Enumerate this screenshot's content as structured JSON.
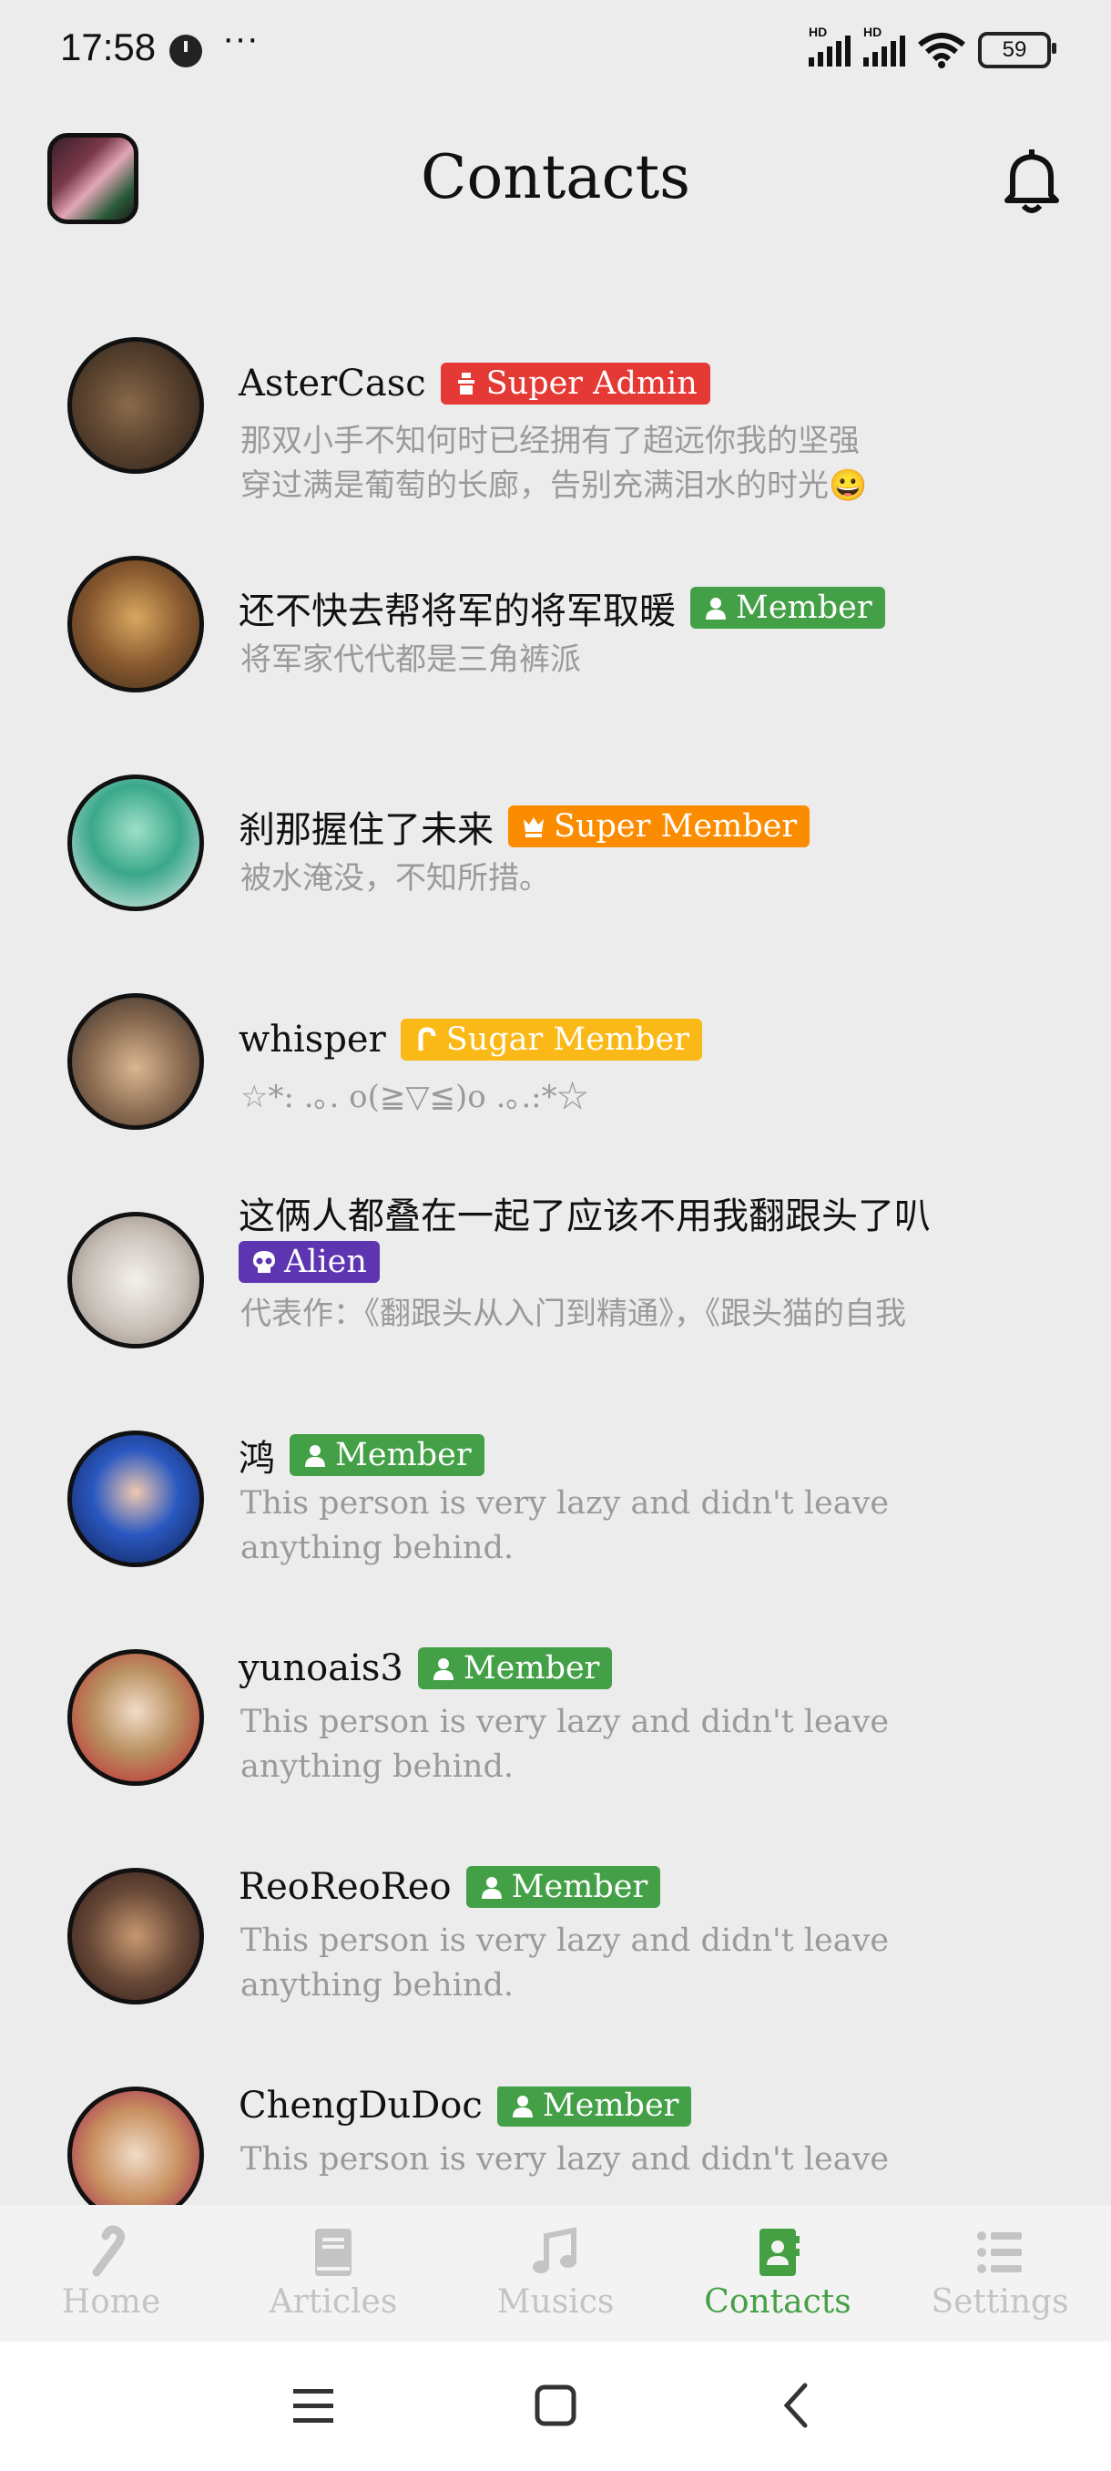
{
  "status": {
    "time": "17:58",
    "dots": "···",
    "battery": "59",
    "hd1": "HD",
    "hd2": "HD"
  },
  "header": {
    "title": "Contacts"
  },
  "contacts": [
    {
      "name": "AsterCasc",
      "badge": "Super Admin",
      "badge_color": "#e53935",
      "badge_icon": "admin-icon",
      "desc_lines": [
        "那双小手不知何时已经拥有了超远你我的坚强",
        "穿过满是葡萄的长廊，告别充满泪水的时光😀"
      ]
    },
    {
      "name": "还不快去帮将军的将军取暖",
      "badge": "Member",
      "badge_color": "#43a047",
      "badge_icon": "person-icon",
      "desc_lines": [
        "将军家代代都是三角裤派"
      ]
    },
    {
      "name": "刹那握住了未来",
      "badge": "Super Member",
      "badge_color": "#fb8c00",
      "badge_icon": "crown-icon",
      "desc_lines": [
        "被水淹没，不知所措。"
      ]
    },
    {
      "name": "whisper",
      "badge": "Sugar Member",
      "badge_color": "#fbb917",
      "badge_icon": "candy-icon",
      "desc_lines": [
        "☆*: .｡. o(≧▽≦)o .｡.:*☆"
      ]
    },
    {
      "name": "这俩人都叠在一起了应该不用我翻跟头了叭",
      "badge": "Alien",
      "badge_color": "#5e35b1",
      "badge_icon": "skull-icon",
      "desc_lines": [
        "代表作：《翻跟头从入门到精通》，《跟头猫的自我"
      ]
    },
    {
      "name": "鸿",
      "badge": "Member",
      "badge_color": "#43a047",
      "badge_icon": "person-icon",
      "desc_lines": [
        "This person is very lazy and didn't leave",
        "anything behind."
      ]
    },
    {
      "name": "yunoais3",
      "badge": "Member",
      "badge_color": "#43a047",
      "badge_icon": "person-icon",
      "desc_lines": [
        "This person is very lazy and didn't leave",
        "anything behind."
      ]
    },
    {
      "name": "ReoReoReo",
      "badge": "Member",
      "badge_color": "#43a047",
      "badge_icon": "person-icon",
      "desc_lines": [
        "This person is very lazy and didn't leave",
        "anything behind."
      ]
    },
    {
      "name": "ChengDuDoc",
      "badge": "Member",
      "badge_color": "#43a047",
      "badge_icon": "person-icon",
      "desc_lines": [
        "This person is very lazy and didn't leave"
      ]
    }
  ],
  "tabs": [
    {
      "label": "Home",
      "icon": "candy-cane-icon",
      "active": false
    },
    {
      "label": "Articles",
      "icon": "book-icon",
      "active": false
    },
    {
      "label": "Musics",
      "icon": "music-note-icon",
      "active": false
    },
    {
      "label": "Contacts",
      "icon": "contacts-icon",
      "active": true
    },
    {
      "label": "Settings",
      "icon": "list-icon",
      "active": false
    }
  ],
  "colors": {
    "accent": "#45a043",
    "background": "#ececec",
    "inactive_tab": "#c4c4c4"
  }
}
